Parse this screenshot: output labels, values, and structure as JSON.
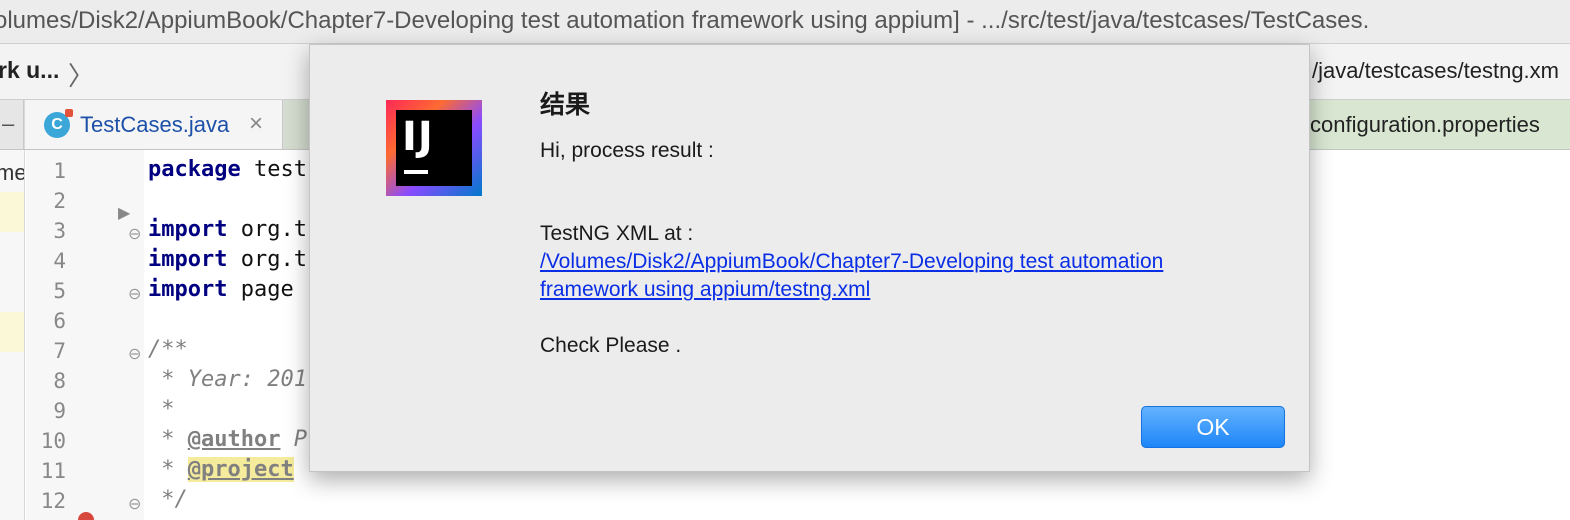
{
  "window": {
    "title": "olumes/Disk2/AppiumBook/Chapter7-Developing test automation framework using appium] - .../src/test/java/testcases/TestCases."
  },
  "navbar": {
    "breadcrumb": "rk u...",
    "path": "/java/testcases/testng.xm"
  },
  "tabs": {
    "left_label": "–",
    "active": {
      "icon": "C",
      "label": "TestCases.java",
      "close": "×"
    },
    "right_label": "configuration.properties"
  },
  "editor": {
    "side_text": "me",
    "line_numbers": [
      "1",
      "2",
      "3",
      "4",
      "5",
      "6",
      "7",
      "8",
      "9",
      "10",
      "11",
      "12"
    ],
    "lines": {
      "l1_kw": "package",
      "l1_rest": " test",
      "l3_kw": "import",
      "l3_rest": " org.t",
      "l4_kw": "import",
      "l4_rest": " org.t",
      "l5_kw": "import",
      "l5_rest": " page",
      "l7": "/**",
      "l8": " * Year: 201",
      "l9": " *",
      "l10_pre": " * ",
      "l10_tag": "@author",
      "l10_rest": " Prat",
      "l11_pre": " * ",
      "l11_tag": "@project",
      "l12": " */"
    }
  },
  "dialog": {
    "title": "结果",
    "greeting": "Hi, process result :",
    "label": "TestNG XML at :",
    "link": "/Volumes/Disk2/AppiumBook/Chapter7-Developing test automation framework using appium/testng.xml",
    "check": "Check Please .",
    "ok_label": "OK",
    "icon_text": "IJ"
  },
  "colors": {
    "keyword": "#000080",
    "link": "#0a2ee6",
    "ok_button": "#1e86f8"
  }
}
